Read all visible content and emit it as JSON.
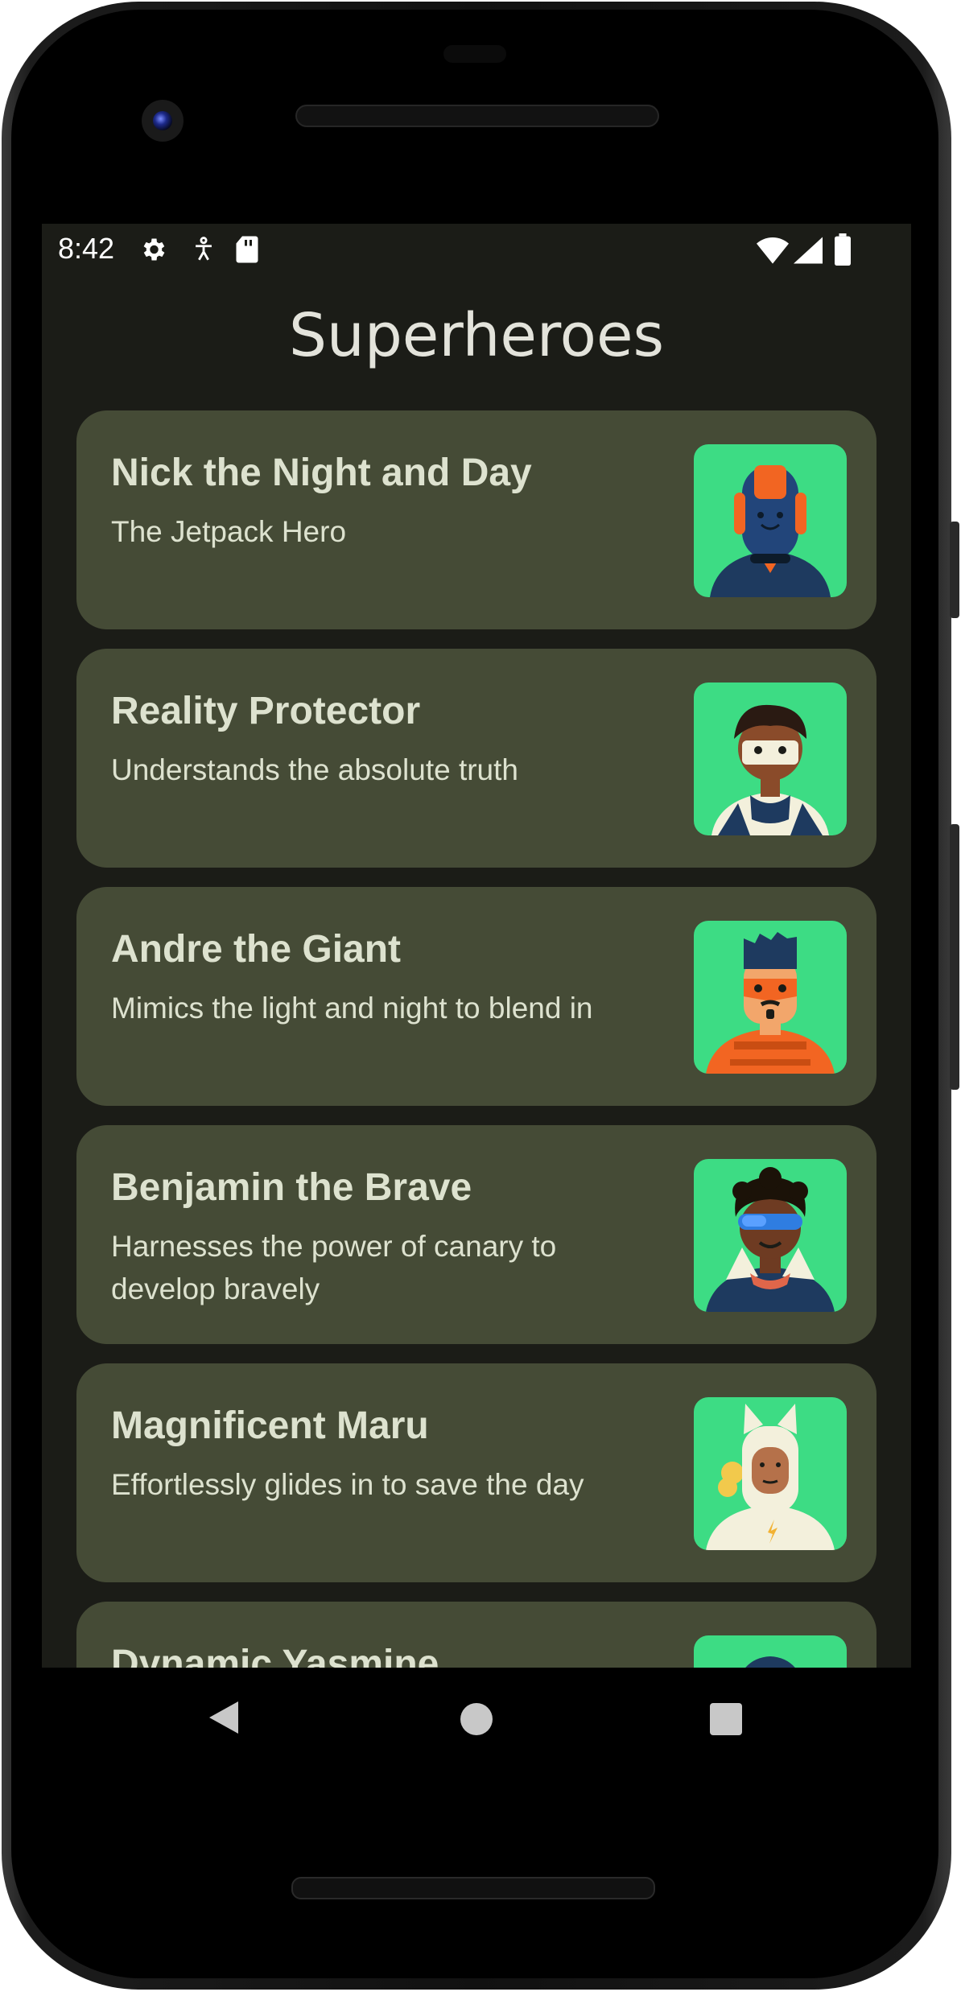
{
  "status_bar": {
    "time": "8:42",
    "left_icons": [
      "settings-icon",
      "accessibility-icon",
      "sd-card-icon"
    ],
    "right_icons": [
      "wifi-icon",
      "signal-icon",
      "battery-icon"
    ]
  },
  "app": {
    "title": "Superheroes"
  },
  "heroes": [
    {
      "name": "Nick the Night and Day",
      "description": "The Jetpack Hero",
      "avatar": "jetpack-hero-avatar-icon"
    },
    {
      "name": "Reality Protector",
      "description": "Understands the absolute truth",
      "avatar": "reality-protector-avatar-icon"
    },
    {
      "name": "Andre the Giant",
      "description": "Mimics the light and night to blend in",
      "avatar": "andre-avatar-icon"
    },
    {
      "name": "Benjamin the Brave",
      "description": "Harnesses the power of canary to develop bravely",
      "avatar": "benjamin-avatar-icon"
    },
    {
      "name": "Magnificent Maru",
      "description": "Effortlessly glides in to save the day",
      "avatar": "maru-avatar-icon"
    },
    {
      "name": "Dynamic Yasmine",
      "description": "",
      "avatar": "yasmine-avatar-icon"
    }
  ],
  "nav_bar": {
    "icons": [
      "back-icon",
      "home-icon",
      "recents-icon"
    ]
  },
  "colors": {
    "background": "#1b1c17",
    "card": "#454b36",
    "avatar_bg": "#3ddc84",
    "text": "#dde2cf"
  }
}
